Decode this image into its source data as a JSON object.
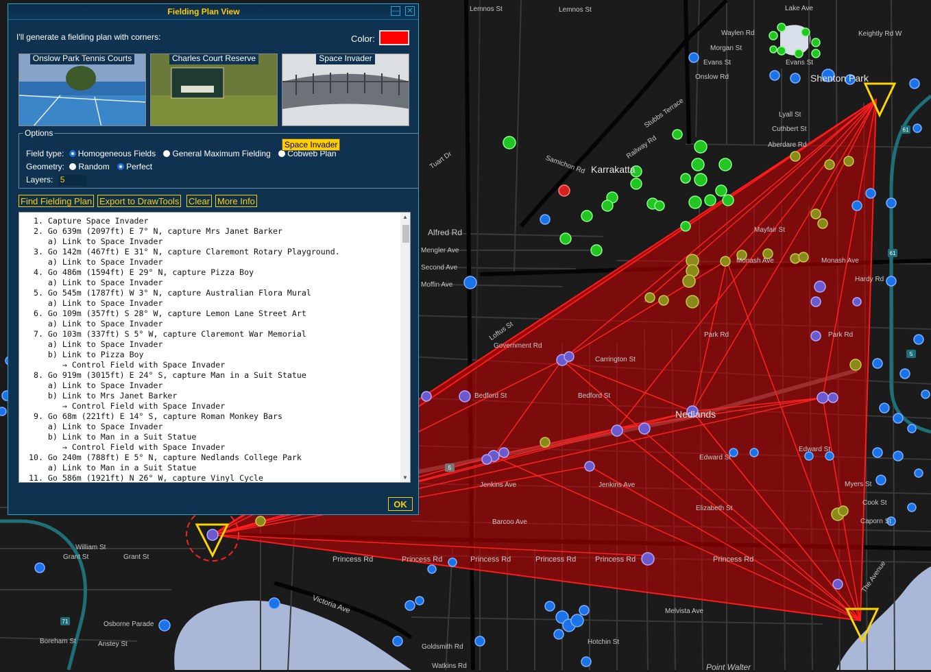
{
  "dialog": {
    "title": "Fielding Plan View",
    "intro": "I'll generate a fielding plan with corners:",
    "color_label": "Color:",
    "color_value": "#ff0000",
    "portals": [
      {
        "name": "Onslow Park Tennis Courts"
      },
      {
        "name": "Charles Court Reserve"
      },
      {
        "name": "Space Invader"
      }
    ],
    "options": {
      "legend": "Options",
      "field_type_label": "Field type:",
      "field_types": [
        "Homogeneous Fields",
        "General Maximum Fielding",
        "Cobweb Plan"
      ],
      "field_type_selected": "Homogeneous Fields",
      "geometry_label": "Geometry:",
      "geometries": [
        "Random",
        "Perfect"
      ],
      "geometry_selected": "Perfect",
      "layers_label": "Layers:",
      "layers_value": "5"
    },
    "tooltip": "Space Invader",
    "buttons": [
      "Find Fielding Plan",
      "Export to DrawTools",
      "Clear",
      "More Info"
    ],
    "plan_lines": [
      " 1. Capture Space Invader",
      " 2. Go 639m (2097ft) E 7° N, capture Mrs Janet Barker",
      "    a) Link to Space Invader",
      " 3. Go 142m (467ft) E 31° N, capture Claremont Rotary Playground.",
      "    a) Link to Space Invader",
      " 4. Go 486m (1594ft) E 29° N, capture Pizza Boy",
      "    a) Link to Space Invader",
      " 5. Go 545m (1787ft) W 3° N, capture Australian Flora Mural",
      "    a) Link to Space Invader",
      " 6. Go 109m (357ft) S 28° W, capture Lemon Lane Street Art",
      "    a) Link to Space Invader",
      " 7. Go 103m (337ft) S 5° W, capture Claremont War Memorial",
      "    a) Link to Space Invader",
      "    b) Link to Pizza Boy",
      "       → Control Field with Space Invader",
      " 8. Go 919m (3015ft) E 24° S, capture Man in a Suit Statue",
      "    a) Link to Space Invader",
      "    b) Link to Mrs Janet Barker",
      "       → Control Field with Space Invader",
      " 9. Go 68m (221ft) E 14° S, capture Roman Monkey Bars",
      "    a) Link to Space Invader",
      "    b) Link to Man in a Suit Statue",
      "       → Control Field with Space Invader",
      "10. Go 240m (788ft) E 5° N, capture Nedlands College Park",
      "    a) Link to Man in a Suit Statue",
      "11. Go 586m (1921ft) N 26° W, capture Vinyl Cycle"
    ],
    "ok_label": "OK"
  },
  "map": {
    "suburbs": [
      "Karrakatta",
      "Shenton Park",
      "Nedlands"
    ],
    "streets": [
      "Lemnos St",
      "Lemnos St",
      "Lake Ave",
      "Waylen Rd",
      "Morgan St",
      "Evans St",
      "Evans St",
      "Onslow Rd",
      "Alfred Rd",
      "Mengler Ave",
      "Second Ave",
      "Moffin Ave",
      "Stubbs Terrace",
      "Railway Rd",
      "Aberdare Rd",
      "Monash Ave",
      "Monash Ave",
      "Park Rd",
      "Park Rd",
      "Hardy Rd",
      "Carrington St",
      "Bedford St",
      "Bedford St",
      "Edward St",
      "Edward St",
      "Jenkins Ave",
      "Jenkins Ave",
      "Barcoo Ave",
      "Elizabeth St",
      "Princess Rd",
      "Princess Rd",
      "Princess Rd",
      "Princess Rd",
      "Princess Rd",
      "Princess Rd",
      "Victoria Ave",
      "Osborne Parade",
      "Boreham St",
      "Anstey St",
      "William St",
      "Grant St",
      "Grant St",
      "Melvista Ave",
      "Hotchin St",
      "Goldsmith Rd",
      "Myers St",
      "Cook St",
      "Caporn St",
      "Government Rd",
      "Loftus St",
      "Lyall St",
      "Cuthbert St",
      "Keightly Rd W",
      "Samichon Rd",
      "Mayfair St",
      "The Avenue",
      "Tuart Dr",
      "Watkins Rd",
      "Point Walter"
    ]
  },
  "colors": {
    "accent": "#ffce00",
    "field": "#ff0000",
    "dialog_bg": "#0e3250"
  }
}
